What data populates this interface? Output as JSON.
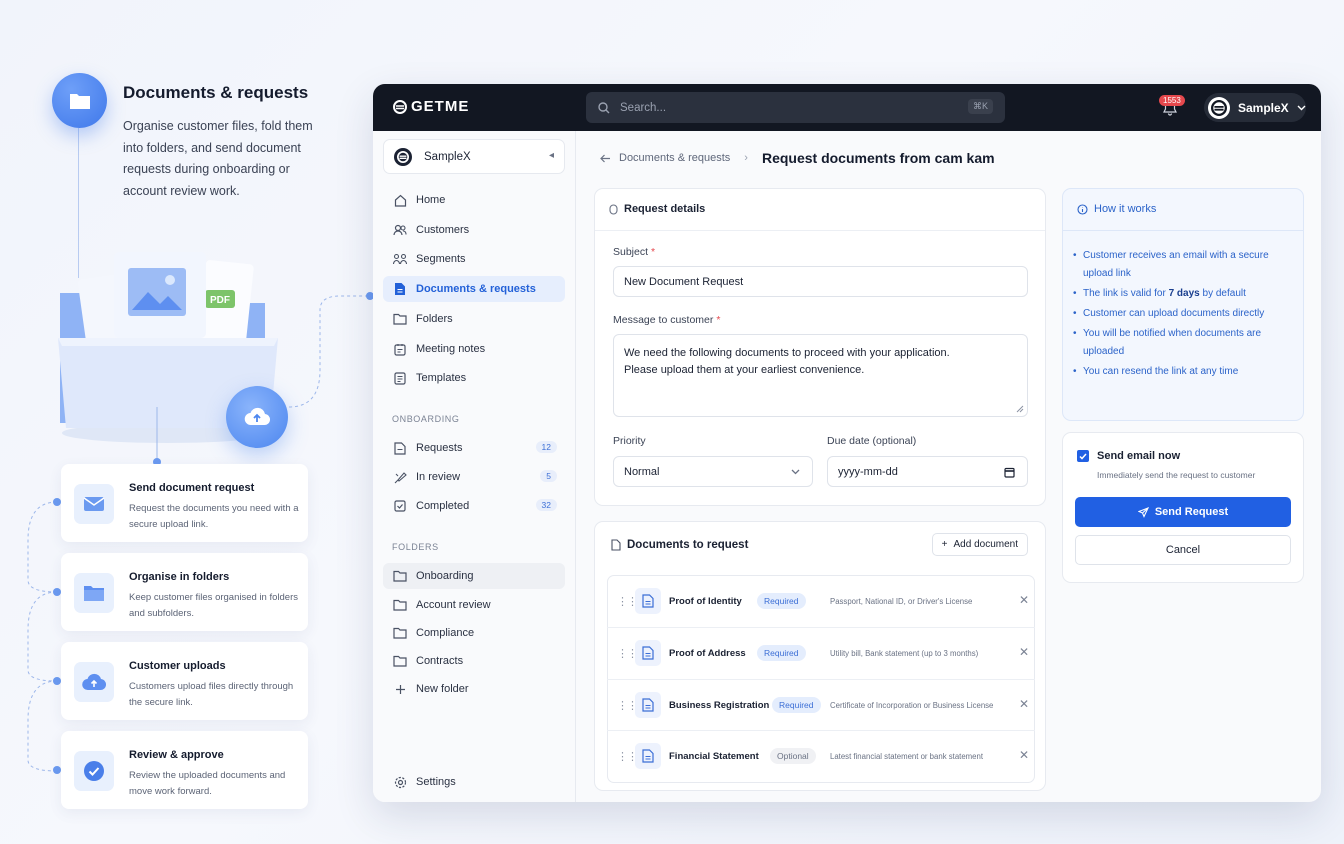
{
  "promo": {
    "title": "Documents & requests",
    "description": "Organise customer files, fold them into folders, and send document requests during onboarding or account review work.",
    "pdf_label": "PDF",
    "steps": [
      {
        "title": "Send document request",
        "desc": "Request the documents you need with a secure upload link."
      },
      {
        "title": "Organise in folders",
        "desc": "Keep customer files organised in folders and subfolders."
      },
      {
        "title": "Customer uploads",
        "desc": "Customers upload files directly through the secure link."
      },
      {
        "title": "Review & approve",
        "desc": "Review the uploaded documents and move work forward."
      }
    ]
  },
  "topbar": {
    "logo": "GETME",
    "search_placeholder": "Search...",
    "search_shortcut": "⌘K",
    "notifications": "1553",
    "account": "SampleX"
  },
  "sidebar": {
    "workspace": "SampleX",
    "items": [
      "Home",
      "Customers",
      "Segments",
      "Documents & requests",
      "Folders",
      "Meeting notes",
      "Templates"
    ],
    "onboarding_title": "ONBOARDING",
    "onboarding": [
      {
        "label": "Requests",
        "count": "12"
      },
      {
        "label": "In review",
        "count": "5"
      },
      {
        "label": "Completed",
        "count": "32"
      }
    ],
    "folders_title": "FOLDERS",
    "folders": [
      "Onboarding",
      "Account review",
      "Compliance",
      "Contracts"
    ],
    "new_folder": "New folder",
    "settings": "Settings"
  },
  "breadcrumb": {
    "parent": "Documents & requests",
    "current": "Request documents from cam kam"
  },
  "form": {
    "title": "Request details",
    "subject_label": "Subject",
    "subject_value": "New Document Request",
    "message_label": "Message to customer",
    "message_line1": "We need the following documents to proceed with your application.",
    "message_line2": "Please upload them at your earliest convenience.",
    "priority_label": "Priority",
    "priority_value": "Normal",
    "due_label": "Due date (optional)",
    "due_placeholder": "yyyy-mm-dd",
    "required_mark": "*"
  },
  "documents": {
    "title": "Documents to request",
    "add_label": "Add document",
    "rows": [
      {
        "name": "Proof of Identity",
        "tag": "Required",
        "desc": "Passport, National ID, or Driver's License"
      },
      {
        "name": "Proof of Address",
        "tag": "Required",
        "desc": "Utility bill, Bank statement (up to 3 months)"
      },
      {
        "name": "Business Registration",
        "tag": "Required",
        "desc": "Certificate of Incorporation or Business License"
      },
      {
        "name": "Financial Statement",
        "tag": "Optional",
        "desc": "Latest financial statement or bank statement"
      }
    ]
  },
  "how": {
    "title": "How it works",
    "items": [
      "Customer receives an email with a secure upload link",
      "The link is valid for 7 days by default",
      "Customer can upload documents directly",
      "You will be notified when documents are uploaded",
      "You can resend the link at any time"
    ]
  },
  "actions": {
    "send_email_label": "Send email now",
    "send_email_desc": "Immediately send the request to customer",
    "send_email_checked": true,
    "send_button": "Send Request",
    "cancel_button": "Cancel"
  },
  "colors": {
    "accent": "#2160e3",
    "topbar": "#121722",
    "required_red": "#e5484d"
  }
}
